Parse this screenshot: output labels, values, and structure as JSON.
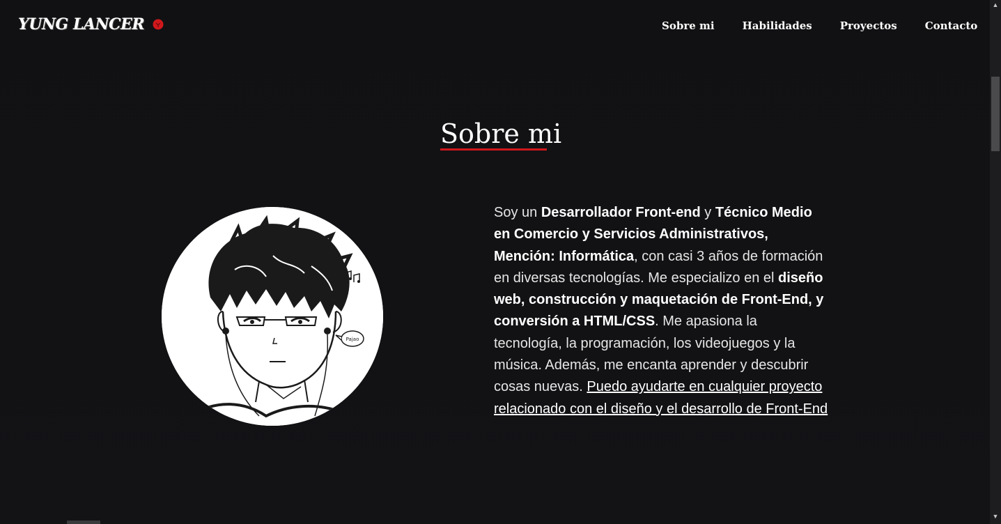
{
  "brand": {
    "logo_text": "YUNG LANCER",
    "badge_color": "#d0181c"
  },
  "nav": {
    "items": [
      {
        "label": "Sobre mi"
      },
      {
        "label": "Habilidades"
      },
      {
        "label": "Proyectos"
      },
      {
        "label": "Contacto"
      }
    ]
  },
  "about": {
    "title": "Sobre mi",
    "accent_color": "#d0181c",
    "avatar_bubble_text": "Pajao",
    "paragraph": [
      {
        "t": "Soy un ",
        "b": false
      },
      {
        "t": "Desarrollador Front-end",
        "b": true
      },
      {
        "t": " y ",
        "b": false
      },
      {
        "t": "Técnico Medio en Comercio y Servicios Administrativos, Mención: Informática",
        "b": true
      },
      {
        "t": ", con casi 3 años de formación en diversas tecnologías. Me especializo en el ",
        "b": false
      },
      {
        "t": "diseño web, construcción y maquetación de Front-End, y conversión a HTML/CSS",
        "b": true
      },
      {
        "t": ". Me apasiona la tecnología, la programación, los videojuegos y la música. Además, me encanta aprender y descubrir cosas nuevas. ",
        "b": false
      }
    ],
    "link_text": "Puedo ayudarte en cualquier proyecto relacionado con el diseño y el desarrollo de Front-End"
  },
  "icons": {
    "scroll_up": "scroll-up-arrow-icon",
    "scroll_down": "scroll-down-arrow-icon"
  }
}
